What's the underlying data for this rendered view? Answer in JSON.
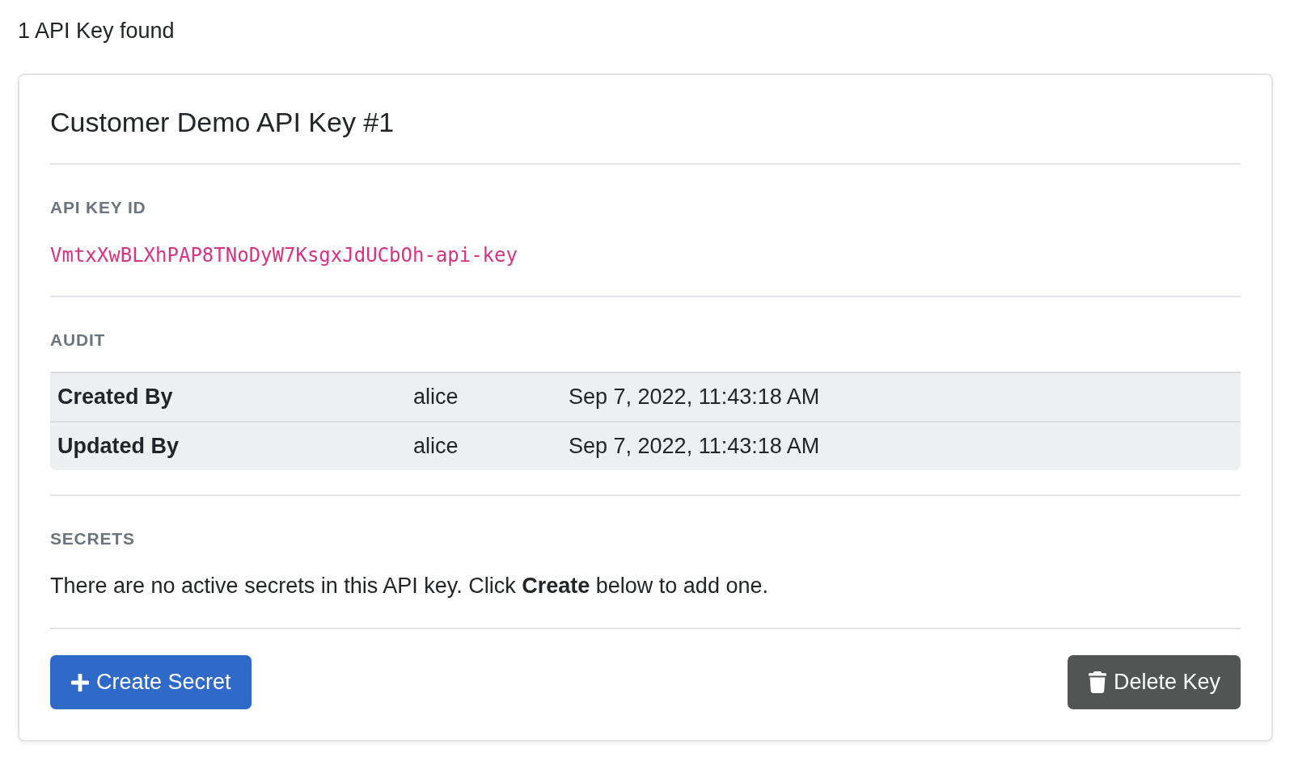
{
  "summary": "1 API Key found",
  "card": {
    "title": "Customer Demo API Key #1",
    "key_id": {
      "label": "API KEY ID",
      "value": "VmtxXwBLXhPAP8TNoDyW7KsgxJdUCbOh-api-key"
    },
    "audit": {
      "label": "AUDIT",
      "rows": [
        {
          "label": "Created By",
          "user": "alice",
          "timestamp": "Sep 7, 2022, 11:43:18 AM"
        },
        {
          "label": "Updated By",
          "user": "alice",
          "timestamp": "Sep 7, 2022, 11:43:18 AM"
        }
      ]
    },
    "secrets": {
      "label": "SECRETS",
      "message": "There are no active secrets in this API key. Click **Create** below to add one."
    },
    "buttons": [
      {
        "kind": "create",
        "label": "Create Secret"
      },
      {
        "kind": "delete",
        "label": "Delete Key"
      }
    ]
  }
}
